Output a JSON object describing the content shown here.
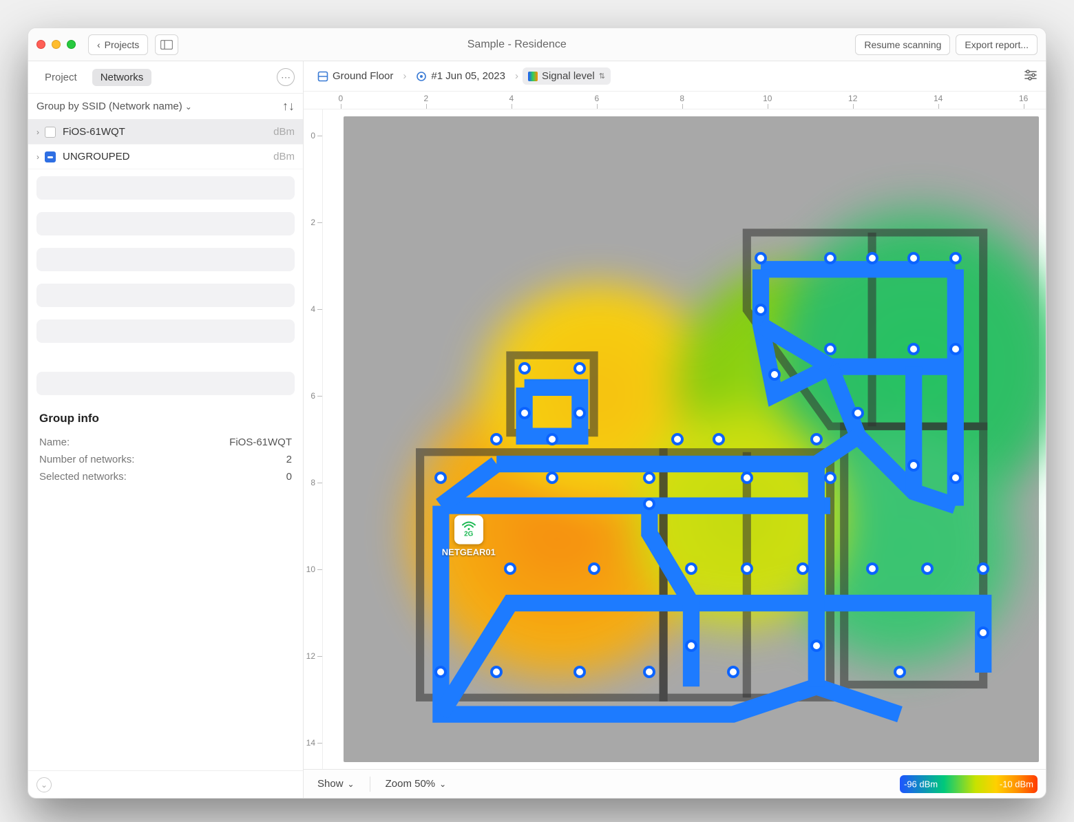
{
  "window": {
    "back_label": "Projects",
    "title": "Sample - Residence",
    "resume_label": "Resume scanning",
    "export_label": "Export report..."
  },
  "sidebar": {
    "tabs": [
      "Project",
      "Networks"
    ],
    "active_tab": 1,
    "group_by_label": "Group by SSID (Network name)",
    "networks": [
      {
        "name": "FiOS-61WQT",
        "unit": "dBm",
        "selected": true,
        "grouped": false
      },
      {
        "name": "UNGROUPED",
        "unit": "dBm",
        "selected": false,
        "grouped": true
      }
    ],
    "group_info": {
      "title": "Group info",
      "name_label": "Name:",
      "name_value": "FiOS-61WQT",
      "count_label": "Number of networks:",
      "count_value": "2",
      "selected_label": "Selected networks:",
      "selected_value": "0"
    }
  },
  "breadcrumb": {
    "floor": "Ground Floor",
    "survey": "#1 Jun 05, 2023",
    "visualization": "Signal level"
  },
  "rulers": {
    "h": [
      "0",
      "2",
      "4",
      "6",
      "8",
      "10",
      "12",
      "14",
      "16"
    ],
    "v": [
      "0",
      "2",
      "4",
      "6",
      "8",
      "10",
      "12",
      "14"
    ]
  },
  "ap": {
    "band": "2G",
    "name": "NETGEAR01"
  },
  "bottom": {
    "show_label": "Show",
    "zoom_label": "Zoom 50%",
    "legend_min": "-96 dBm",
    "legend_max": "-10 dBm"
  },
  "survey_points": [
    [
      14,
      56
    ],
    [
      14,
      86
    ],
    [
      22,
      50
    ],
    [
      22,
      86
    ],
    [
      24,
      70
    ],
    [
      26,
      39
    ],
    [
      26,
      46
    ],
    [
      30,
      50
    ],
    [
      30,
      56
    ],
    [
      34,
      39
    ],
    [
      34,
      86
    ],
    [
      34,
      46
    ],
    [
      36,
      70
    ],
    [
      44,
      56
    ],
    [
      44,
      86
    ],
    [
      44,
      60
    ],
    [
      48,
      50
    ],
    [
      50,
      70
    ],
    [
      50,
      82
    ],
    [
      54,
      50
    ],
    [
      56,
      86
    ],
    [
      58,
      56
    ],
    [
      58,
      70
    ],
    [
      60,
      30
    ],
    [
      60,
      22
    ],
    [
      62,
      40
    ],
    [
      66,
      70
    ],
    [
      68,
      50
    ],
    [
      68,
      82
    ],
    [
      70,
      22
    ],
    [
      70,
      36
    ],
    [
      70,
      56
    ],
    [
      74,
      46
    ],
    [
      76,
      22
    ],
    [
      76,
      70
    ],
    [
      80,
      86
    ],
    [
      82,
      36
    ],
    [
      82,
      54
    ],
    [
      82,
      22
    ],
    [
      84,
      70
    ],
    [
      88,
      36
    ],
    [
      88,
      56
    ],
    [
      88,
      22
    ],
    [
      92,
      70
    ],
    [
      92,
      80
    ]
  ],
  "survey_paths": [
    [
      [
        60,
        22
      ],
      [
        70,
        22
      ],
      [
        76,
        22
      ],
      [
        82,
        22
      ],
      [
        88,
        22
      ]
    ],
    [
      [
        60,
        22
      ],
      [
        60,
        30
      ],
      [
        62,
        40
      ],
      [
        70,
        36
      ],
      [
        82,
        36
      ],
      [
        88,
        36
      ]
    ],
    [
      [
        70,
        36
      ],
      [
        74,
        46
      ],
      [
        82,
        54
      ],
      [
        88,
        56
      ]
    ],
    [
      [
        22,
        50
      ],
      [
        30,
        50
      ],
      [
        48,
        50
      ],
      [
        54,
        50
      ],
      [
        68,
        50
      ],
      [
        74,
        46
      ]
    ],
    [
      [
        26,
        39
      ],
      [
        34,
        39
      ],
      [
        34,
        46
      ],
      [
        26,
        46
      ],
      [
        26,
        39
      ]
    ],
    [
      [
        14,
        56
      ],
      [
        30,
        56
      ],
      [
        44,
        56
      ],
      [
        58,
        56
      ],
      [
        70,
        56
      ]
    ],
    [
      [
        14,
        56
      ],
      [
        14,
        86
      ],
      [
        22,
        86
      ],
      [
        34,
        86
      ],
      [
        44,
        86
      ],
      [
        56,
        86
      ],
      [
        68,
        82
      ],
      [
        80,
        86
      ]
    ],
    [
      [
        14,
        86
      ],
      [
        24,
        70
      ],
      [
        36,
        70
      ],
      [
        50,
        70
      ],
      [
        58,
        70
      ],
      [
        66,
        70
      ],
      [
        76,
        70
      ],
      [
        84,
        70
      ],
      [
        92,
        70
      ],
      [
        92,
        80
      ]
    ],
    [
      [
        44,
        56
      ],
      [
        44,
        60
      ],
      [
        50,
        70
      ],
      [
        50,
        82
      ]
    ],
    [
      [
        82,
        54
      ],
      [
        82,
        36
      ]
    ],
    [
      [
        68,
        50
      ],
      [
        68,
        82
      ]
    ],
    [
      [
        22,
        50
      ],
      [
        14,
        56
      ]
    ],
    [
      [
        88,
        22
      ],
      [
        88,
        36
      ],
      [
        88,
        56
      ]
    ],
    [
      [
        60,
        30
      ],
      [
        70,
        36
      ]
    ]
  ]
}
